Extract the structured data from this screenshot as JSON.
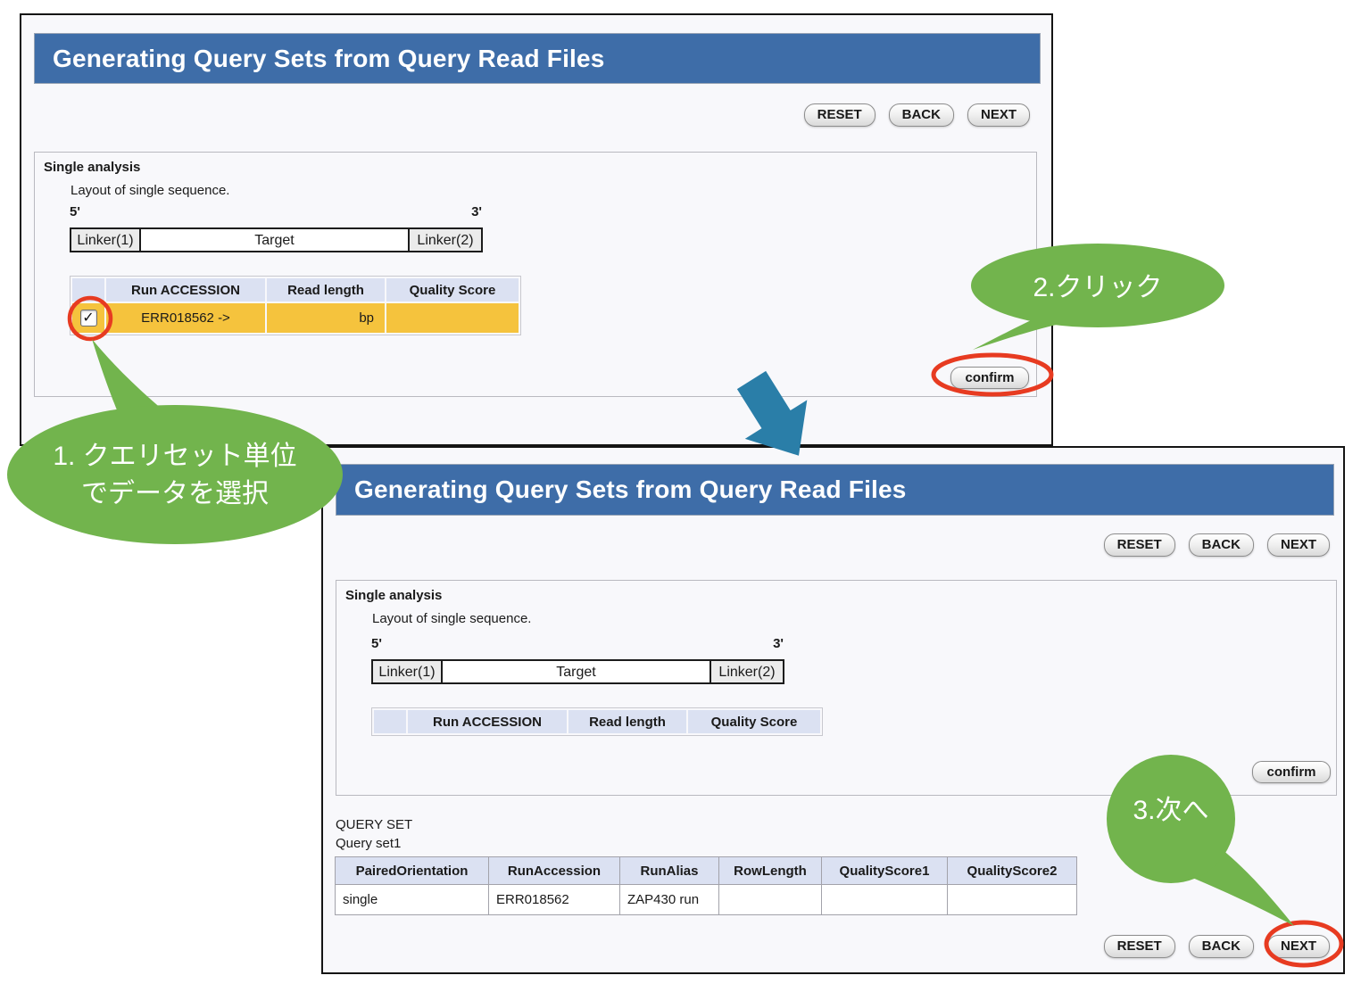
{
  "window1": {
    "title": "Generating Query Sets from Query Read Files",
    "toolbar": {
      "reset": "RESET",
      "back": "BACK",
      "next": "NEXT"
    },
    "section": {
      "title": "Single analysis",
      "subtitle": "Layout of single sequence.",
      "five_prime": "5'",
      "three_prime": "3'",
      "linker1": "Linker(1)",
      "target": "Target",
      "linker2": "Linker(2)",
      "confirm": "confirm"
    },
    "run_table": {
      "headers": [
        "",
        "Run ACCESSION",
        "Read length",
        "Quality Score"
      ],
      "row": {
        "checkbox_checked": true,
        "accession": "ERR018562 ->",
        "read_length": "bp",
        "quality_score": ""
      }
    }
  },
  "window2": {
    "title": "Generating Query Sets from Query Read Files",
    "toolbar": {
      "reset": "RESET",
      "back": "BACK",
      "next": "NEXT"
    },
    "section": {
      "title": "Single analysis",
      "subtitle": "Layout of single sequence.",
      "five_prime": "5'",
      "three_prime": "3'",
      "linker1": "Linker(1)",
      "target": "Target",
      "linker2": "Linker(2)",
      "confirm": "confirm"
    },
    "run_table": {
      "headers": [
        "",
        "Run ACCESSION",
        "Read length",
        "Quality Score"
      ]
    },
    "query_set": {
      "label": "QUERY SET",
      "name": "Query set1",
      "headers": [
        "PairedOrientation",
        "RunAccession",
        "RunAlias",
        "RowLength",
        "QualityScore1",
        "QualityScore2"
      ],
      "row": [
        "single",
        "ERR018562",
        "ZAP430 run",
        "",
        "",
        ""
      ]
    },
    "toolbar_bottom": {
      "reset": "RESET",
      "back": "BACK",
      "next": "NEXT"
    }
  },
  "annotations": {
    "step1_line1": "1. クエリセット単位",
    "step1_line2": "でデータを選択",
    "step2": "2.クリック",
    "step3": "3.次へ"
  },
  "icons": {
    "check": "✓"
  },
  "colors": {
    "header_blue": "#3e6da8",
    "table_header": "#dbe1f2",
    "selected_row_yellow": "#f5c33d",
    "annotation_green": "#72b44d",
    "highlight_red": "#e73b21",
    "arrow_blue": "#2a7ea8"
  }
}
